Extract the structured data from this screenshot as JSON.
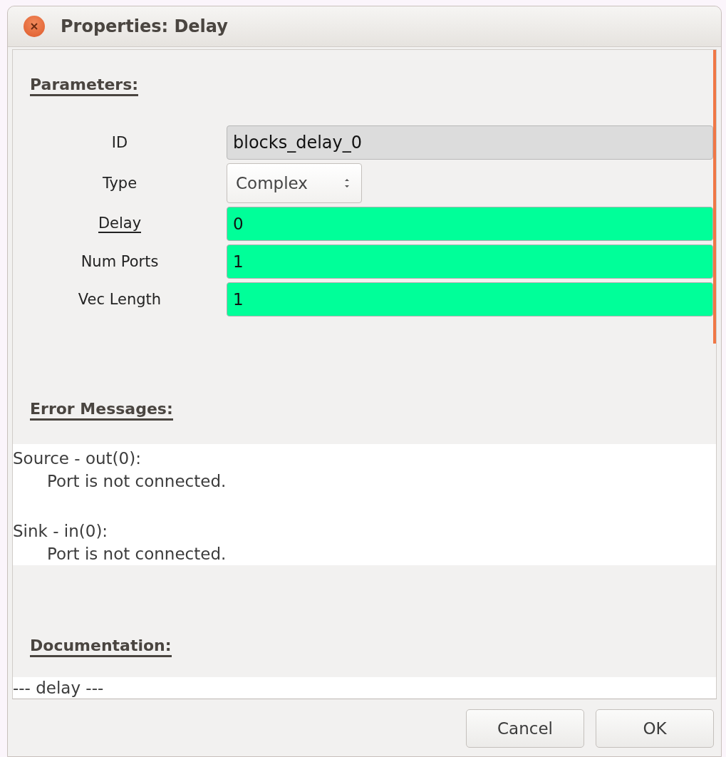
{
  "window": {
    "title": "Properties: Delay"
  },
  "parameters": {
    "heading": "Parameters:",
    "rows": [
      {
        "label": "ID",
        "kind": "readonly",
        "value": "blocks_delay_0",
        "underlined": false
      },
      {
        "label": "Type",
        "kind": "combo",
        "value": "Complex",
        "underlined": false
      },
      {
        "label": "Delay",
        "kind": "entry",
        "value": "0",
        "underlined": true
      },
      {
        "label": "Num Ports",
        "kind": "entry",
        "value": "1",
        "underlined": false
      },
      {
        "label": "Vec Length",
        "kind": "entry",
        "value": "1",
        "underlined": false
      }
    ]
  },
  "error_messages": {
    "heading": "Error Messages:",
    "messages": [
      {
        "source": "Source - out(0):",
        "text": "Port is not connected."
      },
      {
        "source": "Sink - in(0):",
        "text": "Port is not connected."
      }
    ]
  },
  "documentation": {
    "heading": "Documentation:",
    "text": "---  delay  ---"
  },
  "buttons": [
    "Cancel",
    "OK"
  ]
}
